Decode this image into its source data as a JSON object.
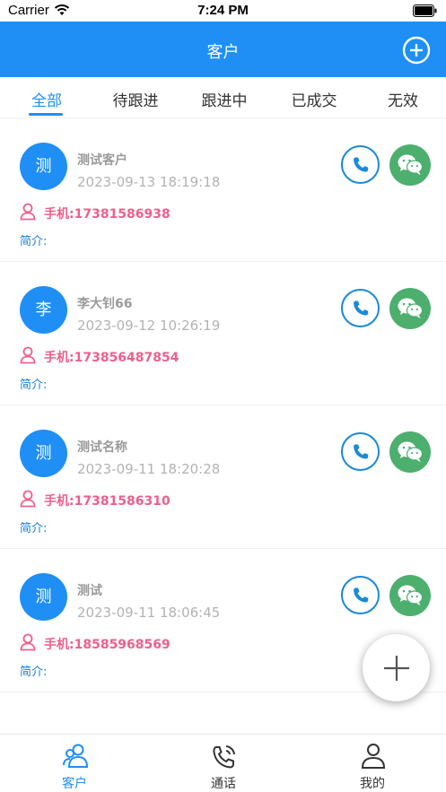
{
  "status_bar": {
    "carrier": "Carrier",
    "time": "7:24 PM"
  },
  "header": {
    "title": "客户",
    "add_icon": "plus-circle-icon"
  },
  "tabs": [
    {
      "label": "全部",
      "active": true
    },
    {
      "label": "待跟进",
      "active": false
    },
    {
      "label": "跟进中",
      "active": false
    },
    {
      "label": "已成交",
      "active": false
    },
    {
      "label": "无效",
      "active": false
    }
  ],
  "customers": [
    {
      "avatar_char": "测",
      "name": "测试客户",
      "date": "2023-09-13 18:19:18",
      "phone": "手机:17381586938",
      "intro": "简介:"
    },
    {
      "avatar_char": "李",
      "name": "李大钊66",
      "date": "2023-09-12 10:26:19",
      "phone": "手机:173856487854",
      "intro": "简介:"
    },
    {
      "avatar_char": "测",
      "name": "测试名称",
      "date": "2023-09-11 18:20:28",
      "phone": "手机:17381586310",
      "intro": "简介:"
    },
    {
      "avatar_char": "测",
      "name": "测试",
      "date": "2023-09-11 18:06:45",
      "phone": "手机:18585968569",
      "intro": "简介:"
    }
  ],
  "tabbar": [
    {
      "label": "客户",
      "icon": "customers-icon",
      "active": true
    },
    {
      "label": "通话",
      "icon": "phone-call-icon",
      "active": false
    },
    {
      "label": "我的",
      "icon": "profile-icon",
      "active": false
    }
  ],
  "colors": {
    "primary": "#1f8ff6",
    "phone_pink": "#ef5f8b",
    "wechat_green": "#4caf6e",
    "intro_blue": "#1a7fd8"
  }
}
